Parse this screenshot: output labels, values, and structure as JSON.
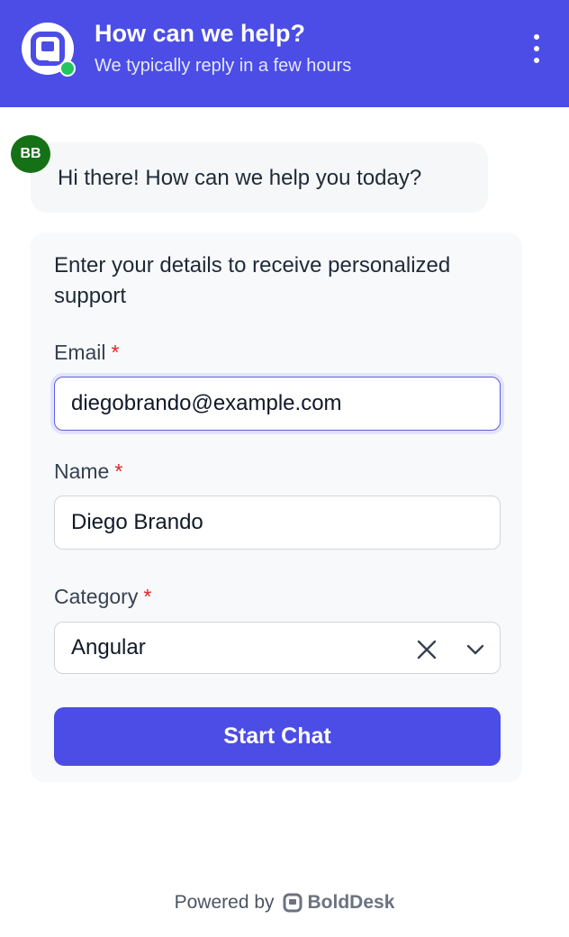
{
  "header": {
    "title": "How can we help?",
    "subtitle": "We typically reply in a few hours",
    "brand_color": "#4b4de6",
    "status_color": "#22c55e",
    "menu_icon": "more-vertical-icon"
  },
  "conversation": {
    "agent_initials": "BB",
    "agent_avatar_color": "#157115",
    "greeting": "Hi there! How can we help you today?"
  },
  "form": {
    "intro": "Enter your details to receive personalized support",
    "email": {
      "label": "Email",
      "required_mark": "*",
      "value": "diegobrando@example.com"
    },
    "name": {
      "label": "Name",
      "required_mark": "*",
      "value": "Diego Brando"
    },
    "category": {
      "label": "Category",
      "required_mark": "*",
      "value": "Angular",
      "clear_icon": "close-icon",
      "dropdown_icon": "chevron-down-icon"
    },
    "submit_label": "Start Chat"
  },
  "footer": {
    "powered_by": "Powered by",
    "brand_name": "BoldDesk",
    "brand_icon": "bolddesk-logo-icon"
  }
}
